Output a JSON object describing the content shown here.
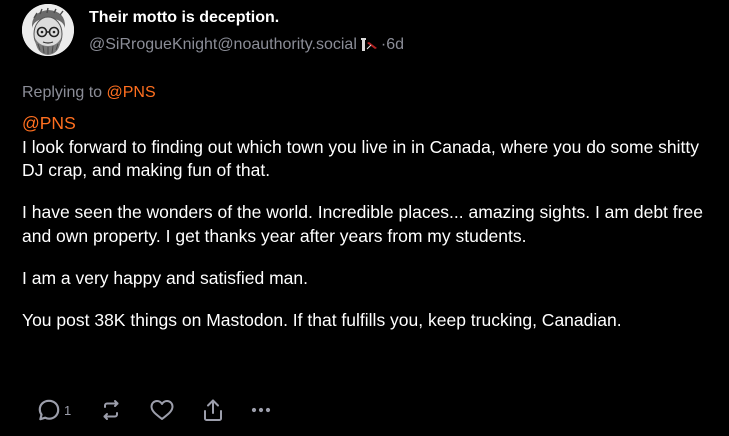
{
  "post": {
    "display_name": "Their motto is deception.",
    "handle": "@SiRrogueKnight@noauthority.social",
    "separator": " · ",
    "time_ago": "6d",
    "reply_prefix": "Replying to ",
    "reply_to": "@PNS",
    "mention": "@PNS",
    "paragraphs": [
      "I look forward to finding out which town you live in in Canada, where you do some shitty DJ crap, and making fun of that.",
      "I have seen the wonders of the world. Incredible places... amazing sights. I am debt free and own property. I get thanks year after years from my students.",
      "I am a very happy and satisfied man.",
      "You post 38K things on Mastodon. If that fulfills you, keep trucking, Canadian."
    ]
  },
  "actions": {
    "reply_count": "1",
    "icons": [
      "reply-icon",
      "boost-icon",
      "favourite-icon",
      "share-icon",
      "more-icon"
    ]
  },
  "colors": {
    "background": "#000000",
    "text": "#ffffff",
    "muted": "#8b8d97",
    "accent": "#ff6f1f",
    "icon": "#9c9eab"
  }
}
